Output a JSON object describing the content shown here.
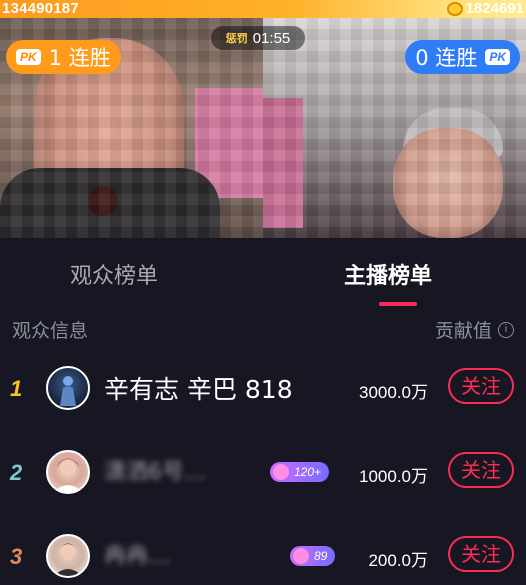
{
  "pk": {
    "left_score": "134490187",
    "right_score": "1824691",
    "timer_tag": "惩罚",
    "timer": "01:55",
    "left_streak": "1 连胜",
    "right_streak": "0 连胜",
    "pk_tag": "PK"
  },
  "tabs": {
    "audience": "观众榜单",
    "host": "主播榜单"
  },
  "list_header": {
    "left": "观众信息",
    "right": "贡献值",
    "info_icon": "i"
  },
  "rows": [
    {
      "rank": "1",
      "rank_color": "#f5c527",
      "name": "辛有志 辛巴 818",
      "value": "3000.0万",
      "follow": "关注",
      "badge": ""
    },
    {
      "rank": "2",
      "rank_color": "#7ec8cc",
      "name": "潇洒6号…",
      "value": "1000.0万",
      "follow": "关注",
      "badge": "120+"
    },
    {
      "rank": "3",
      "rank_color": "#e08a5c",
      "name": "冉冉…",
      "value": "200.0万",
      "follow": "关注",
      "badge": "89"
    }
  ],
  "colors": {
    "accent": "#fe2c55",
    "streak_left": "#ff9b1a",
    "streak_right": "#2f7cf6"
  }
}
